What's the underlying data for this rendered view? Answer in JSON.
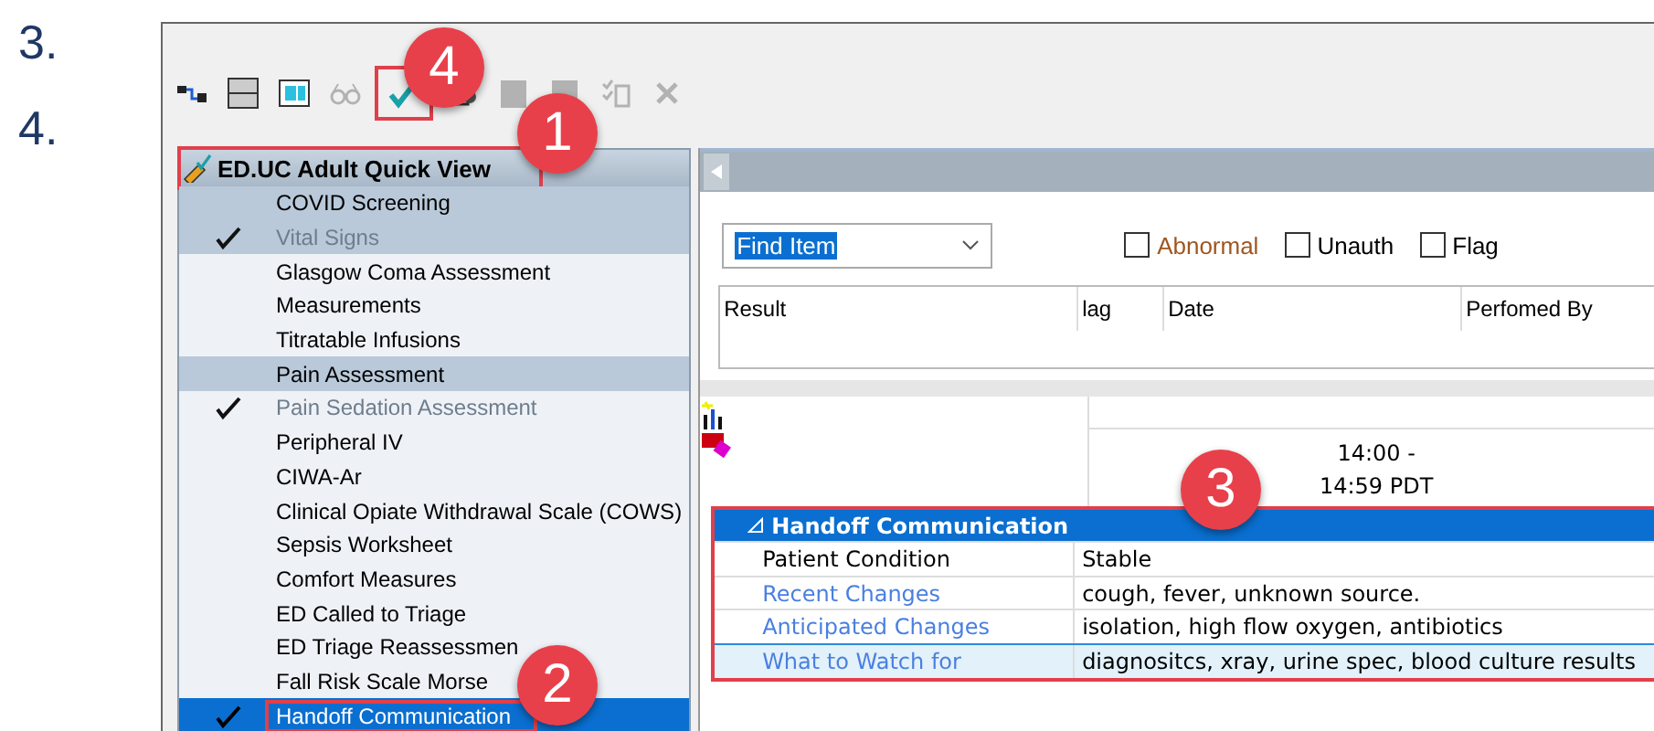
{
  "slide_list": [
    {
      "number": "3."
    },
    {
      "number": "4."
    }
  ],
  "toolbar": [
    {
      "kind": "link",
      "disabled": false,
      "highlighted": false
    },
    {
      "kind": "split",
      "disabled": false,
      "highlighted": false
    },
    {
      "kind": "panel",
      "disabled": false,
      "highlighted": false
    },
    {
      "kind": "glasses",
      "disabled": true,
      "highlighted": false
    },
    {
      "kind": "check",
      "disabled": false,
      "highlighted": true
    },
    {
      "kind": "device",
      "disabled": false,
      "highlighted": false
    },
    {
      "kind": "folder",
      "disabled": true,
      "highlighted": false
    },
    {
      "kind": "folder",
      "disabled": true,
      "highlighted": false
    },
    {
      "kind": "list",
      "disabled": true,
      "highlighted": false
    },
    {
      "kind": "close",
      "disabled": true,
      "highlighted": false
    }
  ],
  "quick_view": {
    "title": "ED.UC Adult Quick View",
    "highlighted": true,
    "items": [
      {
        "label": "COVID Screening",
        "checked": false,
        "shaded": true,
        "selected": false,
        "highlighted": false
      },
      {
        "label": "Vital Signs",
        "checked": true,
        "shaded": true,
        "selected": false,
        "highlighted": false
      },
      {
        "label": "Glasgow Coma Assessment",
        "checked": false,
        "shaded": false,
        "selected": false,
        "highlighted": false
      },
      {
        "label": "Measurements",
        "checked": false,
        "shaded": false,
        "selected": false,
        "highlighted": false
      },
      {
        "label": "Titratable Infusions",
        "checked": false,
        "shaded": false,
        "selected": false,
        "highlighted": false
      },
      {
        "label": "Pain Assessment",
        "checked": false,
        "shaded": true,
        "selected": false,
        "highlighted": false
      },
      {
        "label": "Pain Sedation Assessment",
        "checked": true,
        "shaded": false,
        "selected": false,
        "highlighted": false
      },
      {
        "label": "Peripheral IV",
        "checked": false,
        "shaded": false,
        "selected": false,
        "highlighted": false
      },
      {
        "label": "CIWA-Ar",
        "checked": false,
        "shaded": false,
        "selected": false,
        "highlighted": false
      },
      {
        "label": "Clinical Opiate Withdrawal Scale (COWS)",
        "checked": false,
        "shaded": false,
        "selected": false,
        "highlighted": false
      },
      {
        "label": "Sepsis Worksheet",
        "checked": false,
        "shaded": false,
        "selected": false,
        "highlighted": false
      },
      {
        "label": "Comfort Measures",
        "checked": false,
        "shaded": false,
        "selected": false,
        "highlighted": false
      },
      {
        "label": "ED Called to Triage",
        "checked": false,
        "shaded": false,
        "selected": false,
        "highlighted": false
      },
      {
        "label": "ED Triage Reassessmen",
        "checked": false,
        "shaded": false,
        "selected": false,
        "highlighted": false
      },
      {
        "label": "Fall Risk Scale Morse",
        "checked": false,
        "shaded": false,
        "selected": false,
        "highlighted": false
      },
      {
        "label": "Handoff Communication",
        "checked": true,
        "shaded": false,
        "selected": true,
        "highlighted": true
      }
    ]
  },
  "find": {
    "value": "Find Item"
  },
  "filters": [
    {
      "label": "Abnormal",
      "checked": false,
      "color": "#a0561e"
    },
    {
      "label": "Unauth",
      "checked": false,
      "color": "#000000"
    },
    {
      "label": "Flag",
      "checked": false,
      "color": "#000000"
    }
  ],
  "results_table": {
    "columns": [
      "Result",
      "lag",
      "Date",
      "Perfomed By"
    ]
  },
  "grid": {
    "time_header": [
      "14:00 -",
      "14:59 PDT"
    ],
    "section": {
      "title": "Handoff Communication",
      "expanded": true,
      "highlighted": true,
      "rows": [
        {
          "label": "Patient Condition",
          "value": "Stable",
          "kind": "plain",
          "selected": false
        },
        {
          "label": "Recent Changes",
          "value": "cough, fever, unknown source.",
          "kind": "link",
          "selected": false
        },
        {
          "label": "Anticipated Changes",
          "value": "isolation, high flow oxygen, antibiotics",
          "kind": "link",
          "selected": false
        },
        {
          "label": "What to Watch for",
          "value": "diagnositcs, xray, urine spec, blood culture results",
          "kind": "link",
          "selected": true
        }
      ]
    }
  },
  "callouts": [
    {
      "number": "1"
    },
    {
      "number": "2"
    },
    {
      "number": "3"
    },
    {
      "number": "4"
    }
  ]
}
